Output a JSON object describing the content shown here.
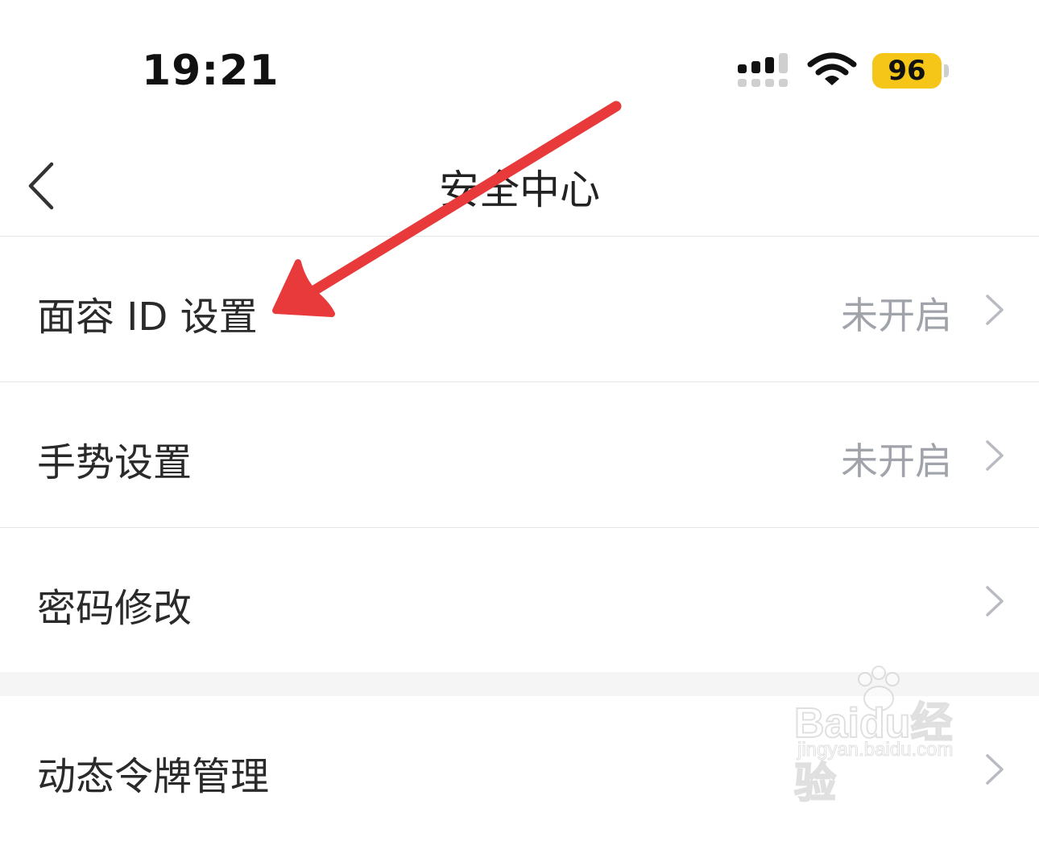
{
  "status_bar": {
    "time": "19:21",
    "battery_level": "96",
    "battery_color": "#f5c518"
  },
  "header": {
    "title": "安全中心",
    "back_icon": "chevron-left-icon"
  },
  "settings": {
    "items": [
      {
        "label": "面容 ID 设置",
        "value": "未开启"
      },
      {
        "label": "手势设置",
        "value": "未开启"
      },
      {
        "label": "密码修改",
        "value": ""
      },
      {
        "label": "动态令牌管理",
        "value": ""
      }
    ]
  },
  "annotation": {
    "color": "#e83a3a",
    "icon": "red-arrow-icon"
  },
  "watermark": {
    "main": "Baidu经验",
    "sub": "jingyan.baidu.com"
  }
}
